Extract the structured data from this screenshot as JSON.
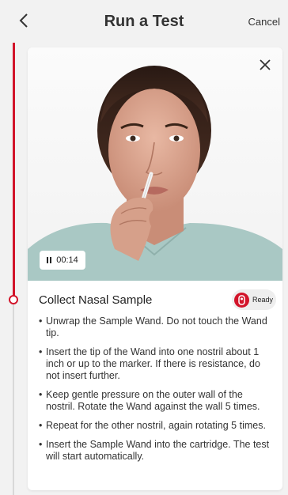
{
  "header": {
    "title": "Run a Test",
    "cancel_label": "Cancel"
  },
  "video": {
    "time": "00:14",
    "state": "paused-control-visible"
  },
  "step": {
    "title": "Collect Nasal Sample",
    "badge_label": "Ready",
    "instructions": [
      "Unwrap the Sample Wand. Do not touch the Wand tip.",
      "Insert the tip of the Wand into one nostril about 1 inch or up to the marker. If there is resistance, do not insert further.",
      "Keep gentle pressure on the outer wall of the nostril. Rotate the Wand against the wall 5 times.",
      "Repeat for the other nostril, again rotating 5 times.",
      "Insert the Sample Wand into the cartridge. The test will start automatically."
    ]
  },
  "colors": {
    "accent": "#d2142a",
    "background": "#f2f2f2",
    "card": "#ffffff",
    "shirt": "#a9c8c4"
  },
  "icons": {
    "back": "chevron-left-icon",
    "close": "close-icon",
    "pause": "pause-icon",
    "ready": "device-icon"
  }
}
